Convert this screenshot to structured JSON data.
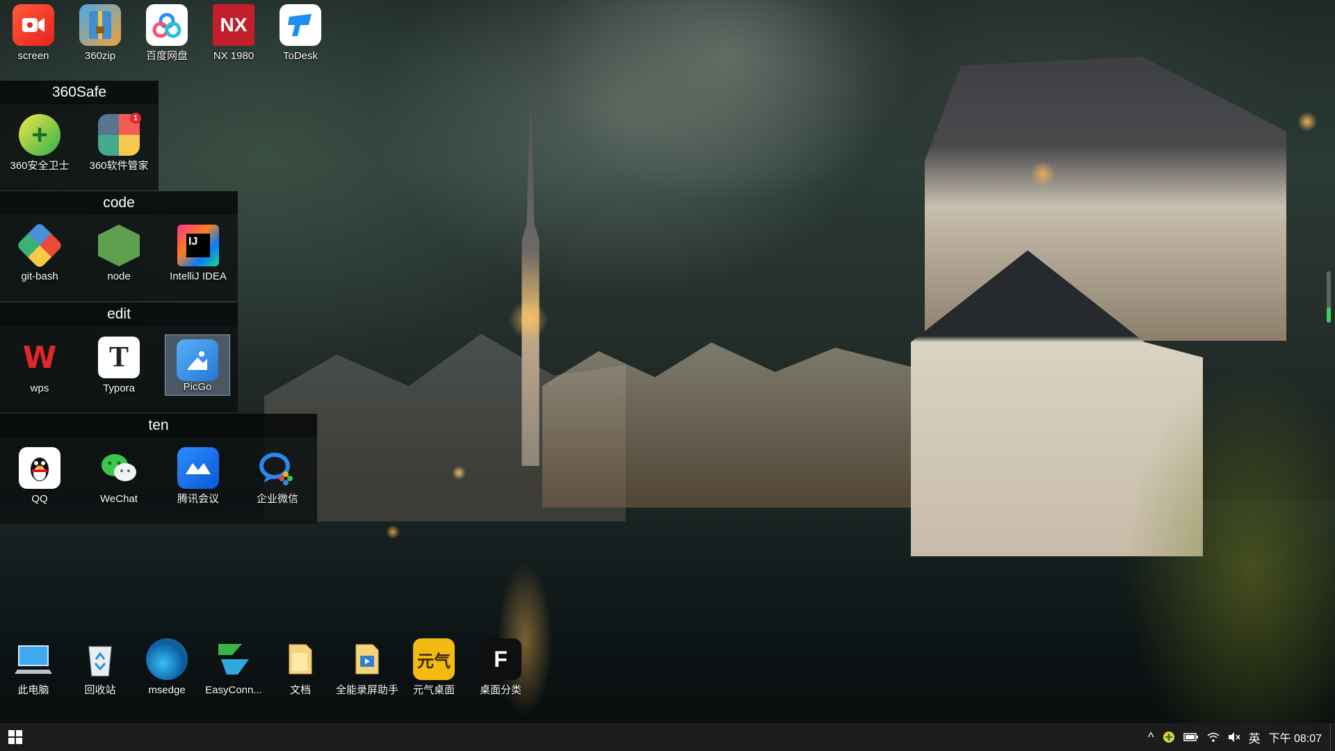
{
  "desktop": {
    "top_icons": [
      {
        "label": "screen",
        "icon": "screen-recorder-icon"
      },
      {
        "label": "360zip",
        "icon": "archive-icon"
      },
      {
        "label": "百度网盘",
        "icon": "cloud-drive-icon"
      },
      {
        "label": "NX 1980",
        "icon": "nx-cad-icon"
      },
      {
        "label": "ToDesk",
        "icon": "remote-desktop-icon"
      }
    ],
    "bottom_icons": [
      {
        "label": "此电脑",
        "icon": "computer-icon"
      },
      {
        "label": "回收站",
        "icon": "recycle-bin-icon"
      },
      {
        "label": "msedge",
        "icon": "edge-browser-icon"
      },
      {
        "label": "EasyConn...",
        "icon": "easyconnect-icon"
      },
      {
        "label": "文档",
        "icon": "folder-icon"
      },
      {
        "label": "全能录屏助手",
        "icon": "screen-record-file-icon"
      },
      {
        "label": "元气桌面",
        "icon": "wallpaper-app-icon"
      },
      {
        "label": "桌面分类",
        "icon": "desktop-organizer-icon"
      }
    ]
  },
  "fences": [
    {
      "title": "360Safe",
      "items": [
        {
          "label": "360安全卫士",
          "icon": "plus-shield-icon"
        },
        {
          "label": "360软件管家",
          "icon": "software-manager-icon",
          "badge": "1"
        }
      ]
    },
    {
      "title": "code",
      "items": [
        {
          "label": "git-bash",
          "icon": "git-icon"
        },
        {
          "label": "node",
          "icon": "nodejs-icon"
        },
        {
          "label": "IntelliJ IDEA",
          "icon": "intellij-icon",
          "glyph": "IJ"
        }
      ]
    },
    {
      "title": "edit",
      "items": [
        {
          "label": "wps",
          "icon": "wps-icon",
          "glyph": "W"
        },
        {
          "label": "Typora",
          "icon": "typora-icon",
          "glyph": "T"
        },
        {
          "label": "PicGo",
          "icon": "picgo-icon",
          "selected": true
        }
      ]
    },
    {
      "title": "ten",
      "items": [
        {
          "label": "QQ",
          "icon": "qq-penguin-icon"
        },
        {
          "label": "WeChat",
          "icon": "wechat-icon"
        },
        {
          "label": "腾讯会议",
          "icon": "tencent-meeting-icon"
        },
        {
          "label": "企业微信",
          "icon": "wecom-icon"
        }
      ]
    }
  ],
  "taskbar": {
    "start": "windows-start-icon",
    "tray": {
      "chevron": "^",
      "ime": "英",
      "clock": "下午 08:07"
    }
  },
  "glyphs": {
    "nx": "NX",
    "yuanqi": "元气",
    "fenlei": "F",
    "plus": "+"
  }
}
